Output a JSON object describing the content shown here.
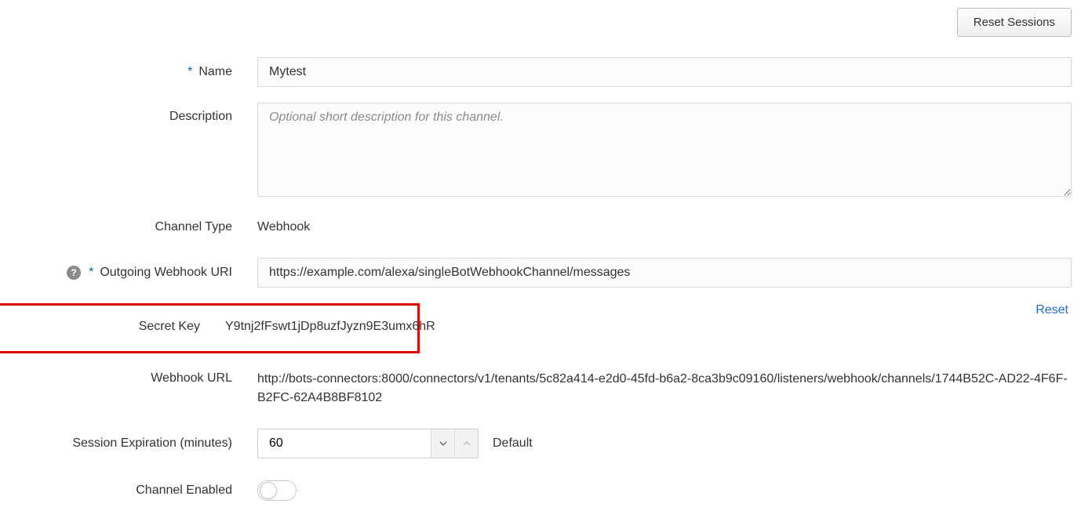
{
  "topbar": {
    "reset_sessions": "Reset Sessions"
  },
  "fields": {
    "name": {
      "label": "Name",
      "value": "Mytest"
    },
    "description": {
      "label": "Description",
      "placeholder": "Optional short description for this channel.",
      "value": ""
    },
    "channel_type": {
      "label": "Channel Type",
      "value": "Webhook"
    },
    "outgoing_uri": {
      "label": "Outgoing Webhook URI",
      "value": "https://example.com/alexa/singleBotWebhookChannel/messages"
    },
    "secret_key": {
      "label": "Secret Key",
      "value": "Y9tnj2fFswt1jDp8uzfJyzn9E3umx6hR",
      "reset": "Reset"
    },
    "webhook_url": {
      "label": "Webhook URL",
      "value": "http://bots-connectors:8000/connectors/v1/tenants/5c82a414-e2d0-45fd-b6a2-8ca3b9c09160/listeners/webhook/channels/1744B52C-AD22-4F6F-B2FC-62A4B8BF8102"
    },
    "session_expiration": {
      "label": "Session Expiration (minutes)",
      "value": "60",
      "default_label": "Default"
    },
    "channel_enabled": {
      "label": "Channel Enabled",
      "value": false
    }
  }
}
